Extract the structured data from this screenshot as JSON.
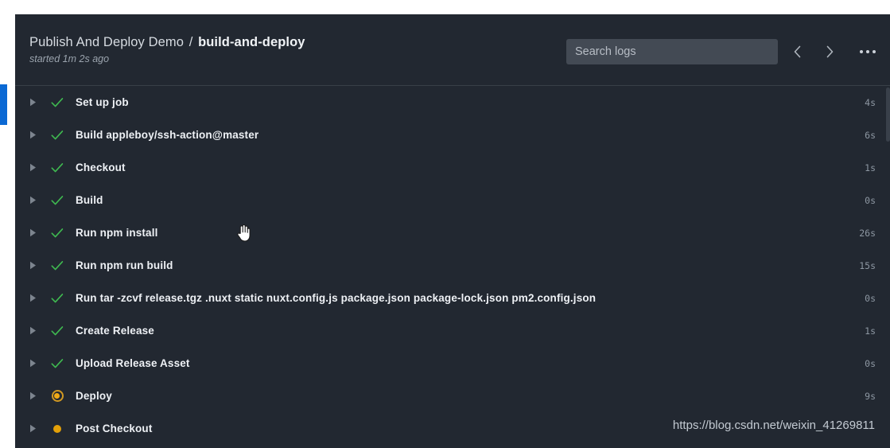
{
  "header": {
    "workflow_name": "Publish And Deploy Demo",
    "separator": "/",
    "job_name": "build-and-deploy",
    "subtitle": "started 1m 2s ago",
    "search": {
      "placeholder": "Search logs",
      "value": ""
    },
    "nav": {
      "previous_icon": "chevron-left-icon",
      "next_icon": "chevron-right-icon",
      "more_icon": "kebab-menu-icon"
    }
  },
  "steps": [
    {
      "label": "Set up job",
      "duration": "4s",
      "status": "success"
    },
    {
      "label": "Build appleboy/ssh-action@master",
      "duration": "6s",
      "status": "success"
    },
    {
      "label": "Checkout",
      "duration": "1s",
      "status": "success"
    },
    {
      "label": "Build",
      "duration": "0s",
      "status": "success"
    },
    {
      "label": "Run npm install",
      "duration": "26s",
      "status": "success"
    },
    {
      "label": "Run npm run build",
      "duration": "15s",
      "status": "success"
    },
    {
      "label": "Run tar -zcvf release.tgz .nuxt static nuxt.config.js package.json package-lock.json pm2.config.json",
      "duration": "0s",
      "status": "success"
    },
    {
      "label": "Create Release",
      "duration": "1s",
      "status": "success"
    },
    {
      "label": "Upload Release Asset",
      "duration": "0s",
      "status": "success"
    },
    {
      "label": "Deploy",
      "duration": "9s",
      "status": "in_progress"
    },
    {
      "label": "Post Checkout",
      "duration": "",
      "status": "queued"
    }
  ],
  "watermark": "https://blog.csdn.net/weixin_41269811",
  "colors": {
    "panel_background": "#222831",
    "header_background": "#222831",
    "divider": "#394048",
    "accent_selection": "#0b69d4",
    "success": "#3fb950",
    "in_progress": "#d29922",
    "queued": "#e3a008",
    "label_text": "#eef1f5",
    "duration_text": "#8d97a2",
    "search_background": "#434a54"
  }
}
